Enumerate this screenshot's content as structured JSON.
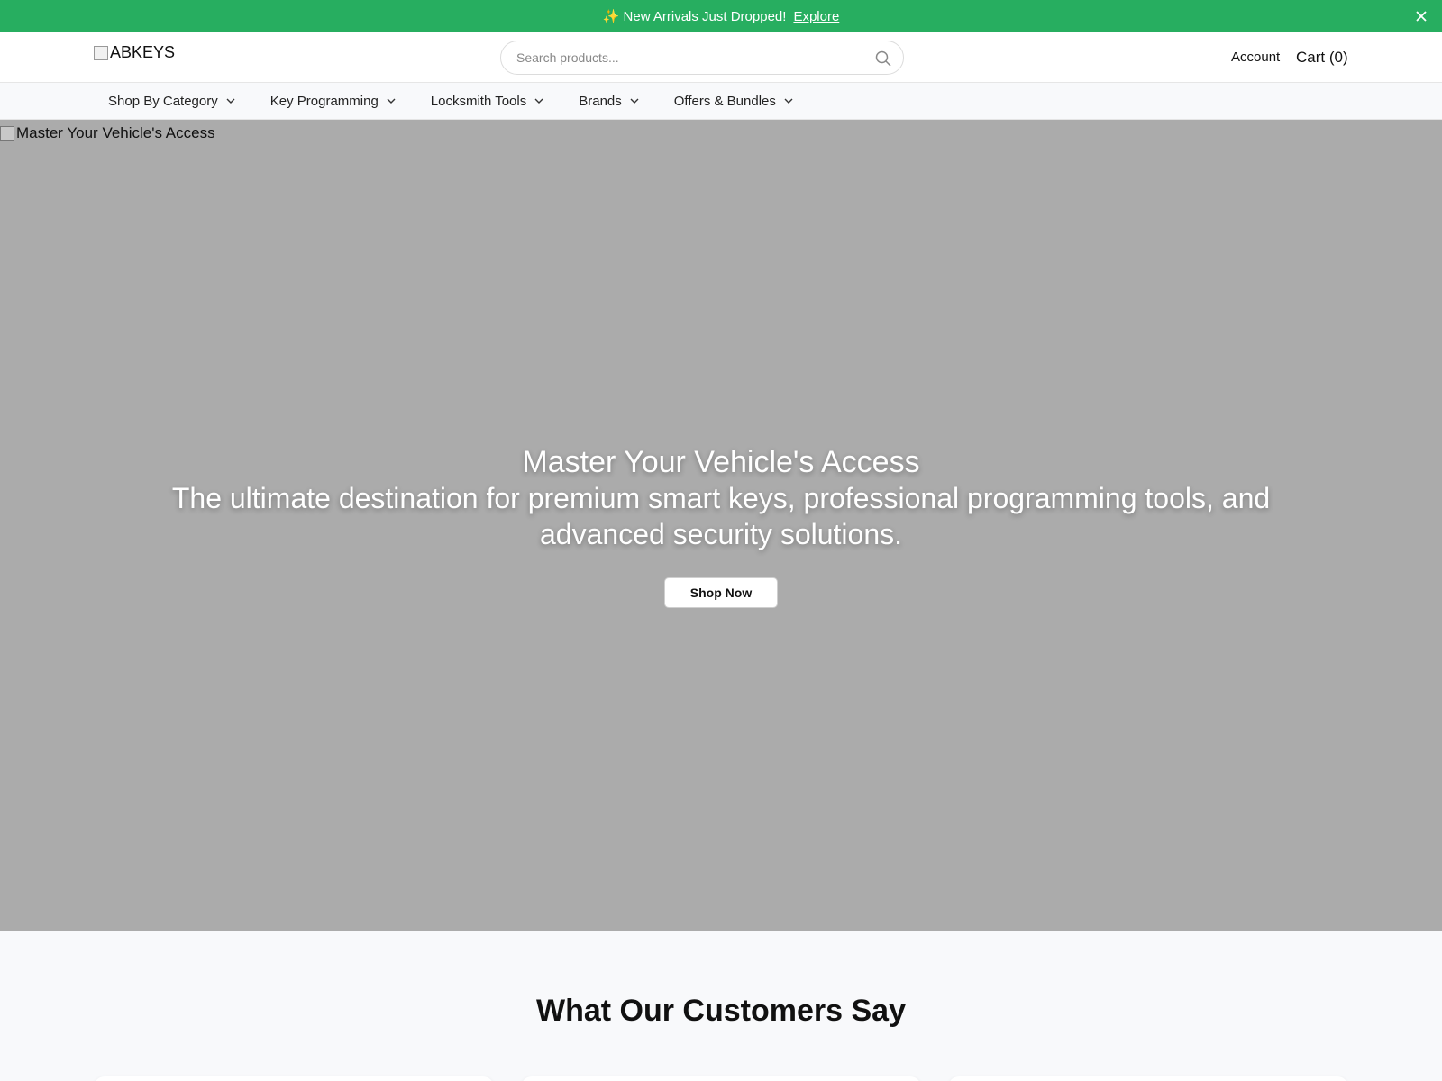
{
  "announcement": {
    "text": "✨ New Arrivals Just Dropped!",
    "link_label": "Explore"
  },
  "header": {
    "logo_alt": "ABKEYS",
    "search_placeholder": "Search products...",
    "account_label": "Account",
    "cart_label": "Cart (0)"
  },
  "nav": {
    "items": [
      {
        "label": "Shop By Category"
      },
      {
        "label": "Key Programming"
      },
      {
        "label": "Locksmith Tools"
      },
      {
        "label": "Brands"
      },
      {
        "label": "Offers & Bundles"
      }
    ]
  },
  "hero": {
    "image_alt": "Master Your Vehicle's Access",
    "title": "Master Your Vehicle's Access",
    "subtitle": "The ultimate destination for premium smart keys, professional programming tools, and advanced security solutions.",
    "cta_label": "Shop Now"
  },
  "testimonials": {
    "heading": "What Our Customers Say"
  },
  "colors": {
    "announcement_bg": "#27ae60",
    "hero_bg": "#ababab"
  }
}
